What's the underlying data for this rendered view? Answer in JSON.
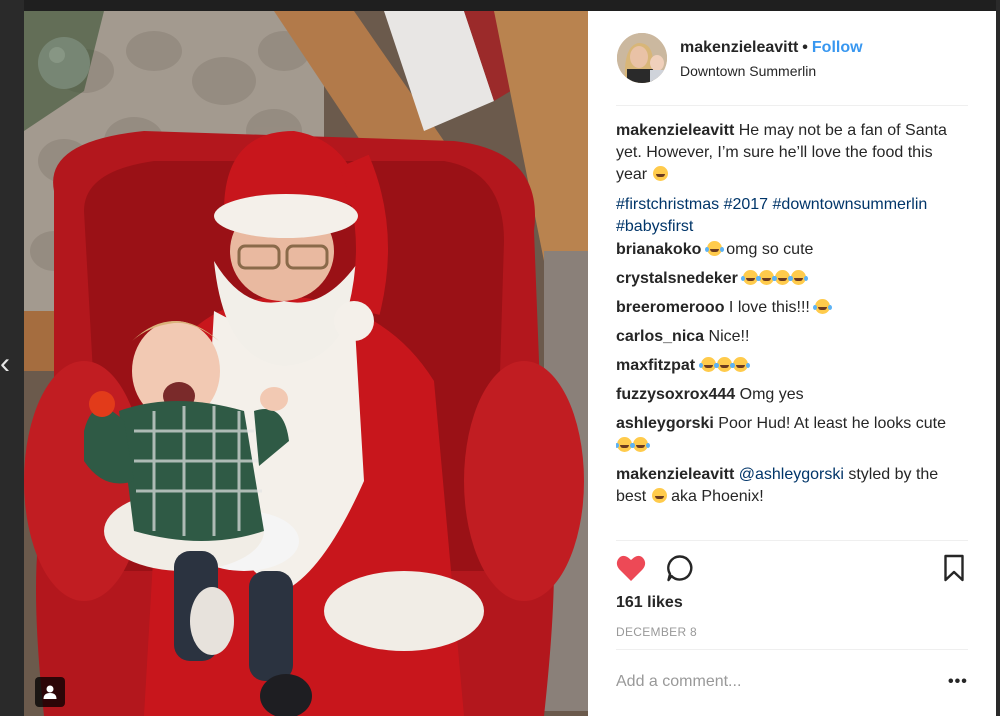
{
  "post": {
    "username": "makenzieleavitt",
    "follow_label": "Follow",
    "separator": "•",
    "location": "Downtown Summerlin",
    "caption": {
      "username": "makenzieleavitt",
      "text": "He may not be a fan of Santa yet. However, I’m sure he’ll love the food this year"
    },
    "hashtags": [
      "#firstchristmas",
      "#2017",
      "#downtownsummerlin",
      "#babysfirst"
    ],
    "comments": [
      {
        "username": "brianakoko",
        "text": "omg so cute",
        "emoji_before": 1,
        "emoji_after": 0
      },
      {
        "username": "crystalsnedeker",
        "text": "",
        "emoji_before": 0,
        "emoji_after": 4
      },
      {
        "username": "breeromerooo",
        "text": "I love this!!!",
        "emoji_before": 0,
        "emoji_after": 1
      },
      {
        "username": "carlos_nica",
        "text": "Nice!!",
        "emoji_before": 0,
        "emoji_after": 0
      },
      {
        "username": "maxfitzpat",
        "text": "",
        "emoji_before": 0,
        "emoji_after": 3
      },
      {
        "username": "fuzzysoxrox444",
        "text": "Omg yes",
        "emoji_before": 0,
        "emoji_after": 0
      },
      {
        "username": "ashleygorski",
        "text": "Poor Hud! At least he looks cute",
        "emoji_before": 0,
        "emoji_after": 2
      },
      {
        "username": "makenzieleavitt",
        "mention": "@ashleygorski",
        "text_a": "styled by the best",
        "text_b": "aka Phoenix!",
        "emoji_before": 0,
        "emoji_after": 0
      }
    ],
    "likes": "161 likes",
    "date": "DECEMBER 8",
    "add_comment_placeholder": "Add a comment...",
    "more_label": "•••"
  },
  "icons": {
    "heart": "heart-icon",
    "comment": "comment-bubble-icon",
    "bookmark": "bookmark-icon",
    "tag": "person-tag-icon",
    "prev": "chevron-left-icon"
  },
  "colors": {
    "link": "#3897f0",
    "hashtag": "#003569",
    "heart": "#ed4956",
    "text": "#262626",
    "muted": "#999999"
  }
}
